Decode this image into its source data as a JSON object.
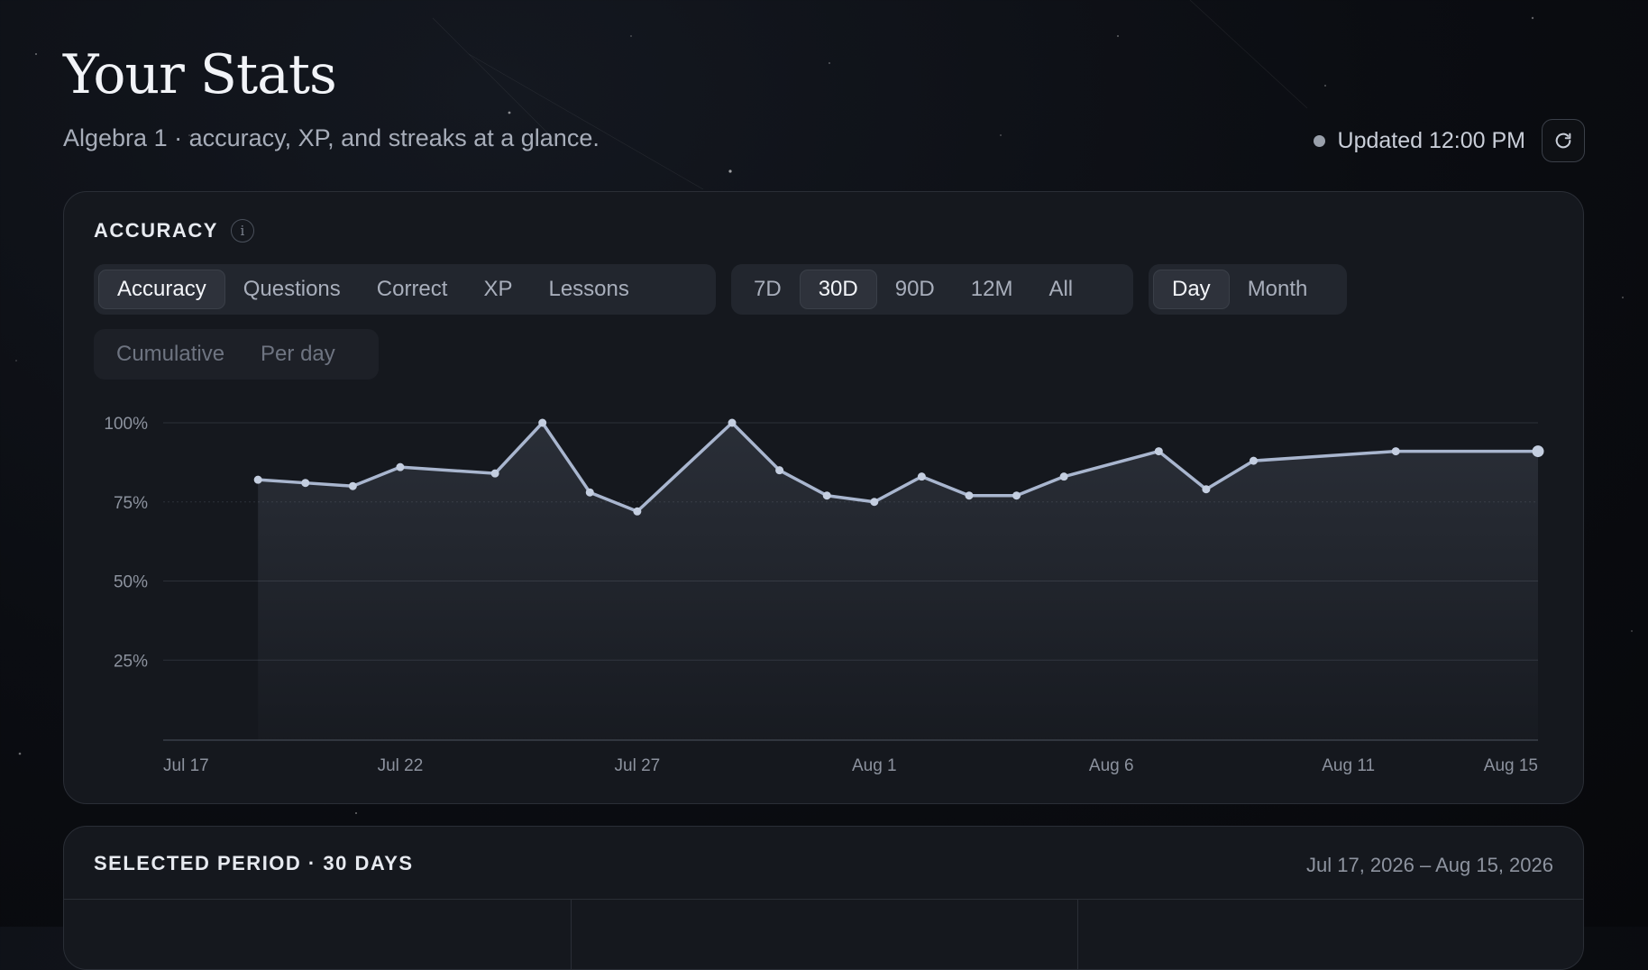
{
  "header": {
    "title": "Your Stats",
    "subtitle": "Algebra 1 · accuracy, XP, and streaks at a glance.",
    "updated": "Updated 12:00 PM",
    "refresh_icon": "refresh-icon"
  },
  "accuracy_card": {
    "label": "ACCURACY",
    "info_icon": "i",
    "metric_tabs": [
      "Accuracy",
      "Questions",
      "Correct",
      "XP",
      "Lessons"
    ],
    "metric_selected": "Accuracy",
    "range_tabs": [
      "7D",
      "30D",
      "90D",
      "12M",
      "All"
    ],
    "range_selected": "30D",
    "granularity_tabs": [
      "Day",
      "Month"
    ],
    "granularity_selected": "Day",
    "mode_tabs": [
      "Cumulative",
      "Per day"
    ]
  },
  "chart_data": {
    "type": "area",
    "x_tick_labels": [
      "Jul 17",
      "Jul 22",
      "Jul 27",
      "Aug 1",
      "Aug 6",
      "Aug 11",
      "Aug 15"
    ],
    "y_tick_labels": [
      "100%",
      "75%",
      "50%",
      "25%"
    ],
    "ylim": [
      0,
      100
    ],
    "grid": true,
    "x_start": "Jul 17",
    "x_end": "Aug 15",
    "x": [
      "Jul 19",
      "Jul 20",
      "Jul 21",
      "Jul 22",
      "Jul 24",
      "Jul 25",
      "Jul 26",
      "Jul 27",
      "Jul 29",
      "Jul 30",
      "Jul 31",
      "Aug 1",
      "Aug 2",
      "Aug 3",
      "Aug 4",
      "Aug 5",
      "Aug 7",
      "Aug 8",
      "Aug 9",
      "Aug 12",
      "Aug 15"
    ],
    "values": [
      82,
      81,
      80,
      86,
      84,
      100,
      78,
      72,
      100,
      85,
      77,
      75,
      83,
      77,
      77,
      83,
      91,
      79,
      88,
      91,
      91
    ],
    "colors": {
      "line": "#a9b6cf",
      "grid": "#2c3038",
      "axis_text": "#8c929e"
    }
  },
  "period_card": {
    "label": "SELECTED PERIOD · 30 DAYS",
    "range": "Jul 17, 2026 – Aug 15, 2026"
  }
}
